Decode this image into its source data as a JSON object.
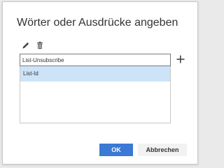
{
  "dialog": {
    "title": "Wörter oder Ausdrücke angeben",
    "toolbar": {
      "edit_icon": "pencil-icon",
      "delete_icon": "trash-icon"
    },
    "input": {
      "value": "List-Unsubscribe"
    },
    "add_icon": "plus-icon",
    "list": {
      "items": [
        {
          "label": "List-Id",
          "selected": true
        }
      ]
    },
    "buttons": {
      "ok_label": "OK",
      "cancel_label": "Abbrechen"
    }
  },
  "colors": {
    "primary": "#3b79d4",
    "selection": "#cde3f7",
    "secondary_button": "#f2f2f2",
    "text": "#333333"
  }
}
